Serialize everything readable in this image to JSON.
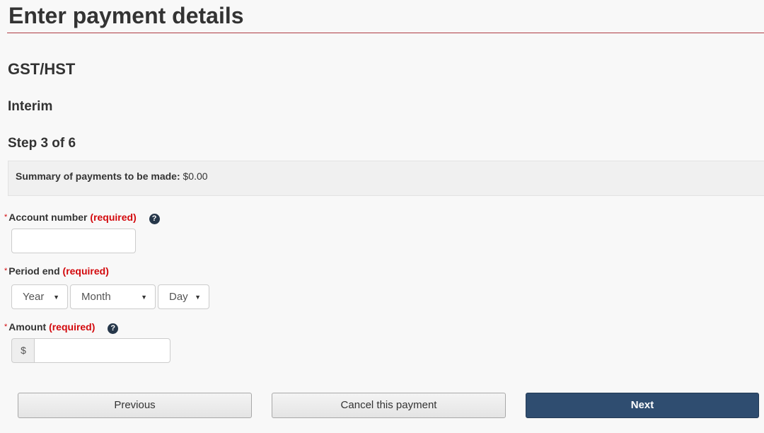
{
  "page": {
    "title": "Enter payment details",
    "program": "GST/HST",
    "payment_type": "Interim",
    "step": "Step 3 of 6"
  },
  "summary": {
    "label": "Summary of payments to be made:",
    "value": "$0.00"
  },
  "fields": {
    "account_number": {
      "asterisk": "*",
      "label": "Account number",
      "required_text": "(required)",
      "help_icon": "question-circle-icon",
      "value": ""
    },
    "period_end": {
      "asterisk": "*",
      "label": "Period end",
      "required_text": "(required)",
      "year": {
        "selected": "Year",
        "icon": "caret-down-icon"
      },
      "month": {
        "selected": "Month",
        "icon": "caret-down-icon"
      },
      "day": {
        "selected": "Day",
        "icon": "caret-down-icon"
      }
    },
    "amount": {
      "asterisk": "*",
      "label": "Amount",
      "required_text": "(required)",
      "help_icon": "question-circle-icon",
      "currency_symbol": "$",
      "value": ""
    }
  },
  "buttons": {
    "previous": "Previous",
    "cancel": "Cancel this payment",
    "next": "Next"
  },
  "colors": {
    "title_rule": "#af3c43",
    "required": "#d3080c",
    "primary_button": "#2f4d70",
    "help_icon": "#26374a"
  }
}
